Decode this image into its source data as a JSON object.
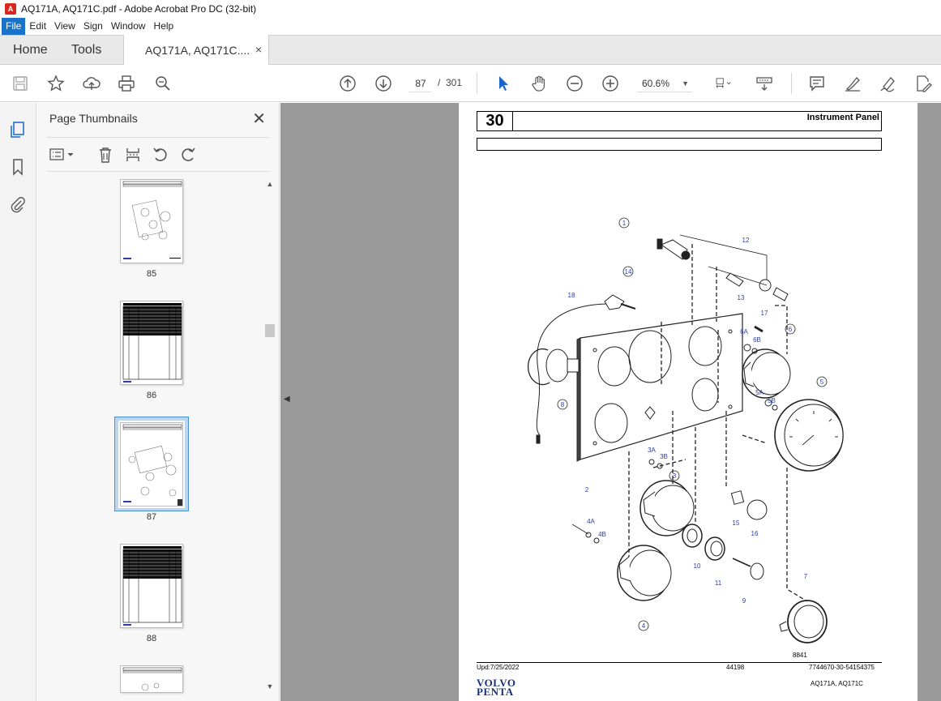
{
  "window": {
    "title": "AQ171A, AQ171C.pdf - Adobe Acrobat Pro DC (32-bit)",
    "app_icon": "acrobat-icon"
  },
  "menu": [
    "File",
    "Edit",
    "View",
    "Sign",
    "Window",
    "Help"
  ],
  "tabs": {
    "home": "Home",
    "tools": "Tools",
    "document": "AQ171A, AQ171C....",
    "close": "×"
  },
  "toolbar": {
    "current_page": "87",
    "separator": "/",
    "total_pages": "301",
    "zoom": "60.6%",
    "icons": [
      "save-icon",
      "star-icon",
      "upload-icon",
      "print-icon",
      "search-zoom-icon",
      "page-up-icon",
      "page-down-icon",
      "select-arrow-icon",
      "hand-icon",
      "zoom-out-icon",
      "zoom-in-icon",
      "fit-page-icon",
      "read-mode-icon",
      "comment-icon",
      "highlight-icon",
      "sign-icon",
      "edit-pdf-icon"
    ]
  },
  "left_rail": {
    "icons": [
      "page-thumbnails-icon",
      "bookmark-icon",
      "attachment-icon"
    ]
  },
  "thumbnail_panel": {
    "title": "Page Thumbnails",
    "close": "✕",
    "pages": [
      {
        "label": "85",
        "kind": "diagram"
      },
      {
        "label": "86",
        "kind": "table"
      },
      {
        "label": "87",
        "kind": "diagram",
        "selected": true
      },
      {
        "label": "88",
        "kind": "table"
      },
      {
        "label": "",
        "kind": "diagram"
      }
    ]
  },
  "document_page": {
    "section_number": "30",
    "section_title": "Instrument Panel",
    "update": "Upd:7/25/2022",
    "code": "44198",
    "part_no": "7744670-30-54154375",
    "figure_no": "8841",
    "models": "AQ171A, AQ171C",
    "brand_line1": "VOLVO",
    "brand_line2": "PENTA",
    "callouts": [
      "1",
      "2",
      "3",
      "3A",
      "3B",
      "4",
      "4A",
      "4B",
      "5",
      "5A",
      "5B",
      "6",
      "6A",
      "6B",
      "7",
      "8",
      "9",
      "10",
      "11",
      "12",
      "13",
      "14",
      "15",
      "16",
      "17",
      "18"
    ]
  },
  "colors": {
    "menu_active": "#1a73c8",
    "callout_blue": "#2a3ea8",
    "viewer_bg": "#9a9a9a",
    "selection": "#4a8fd6"
  }
}
